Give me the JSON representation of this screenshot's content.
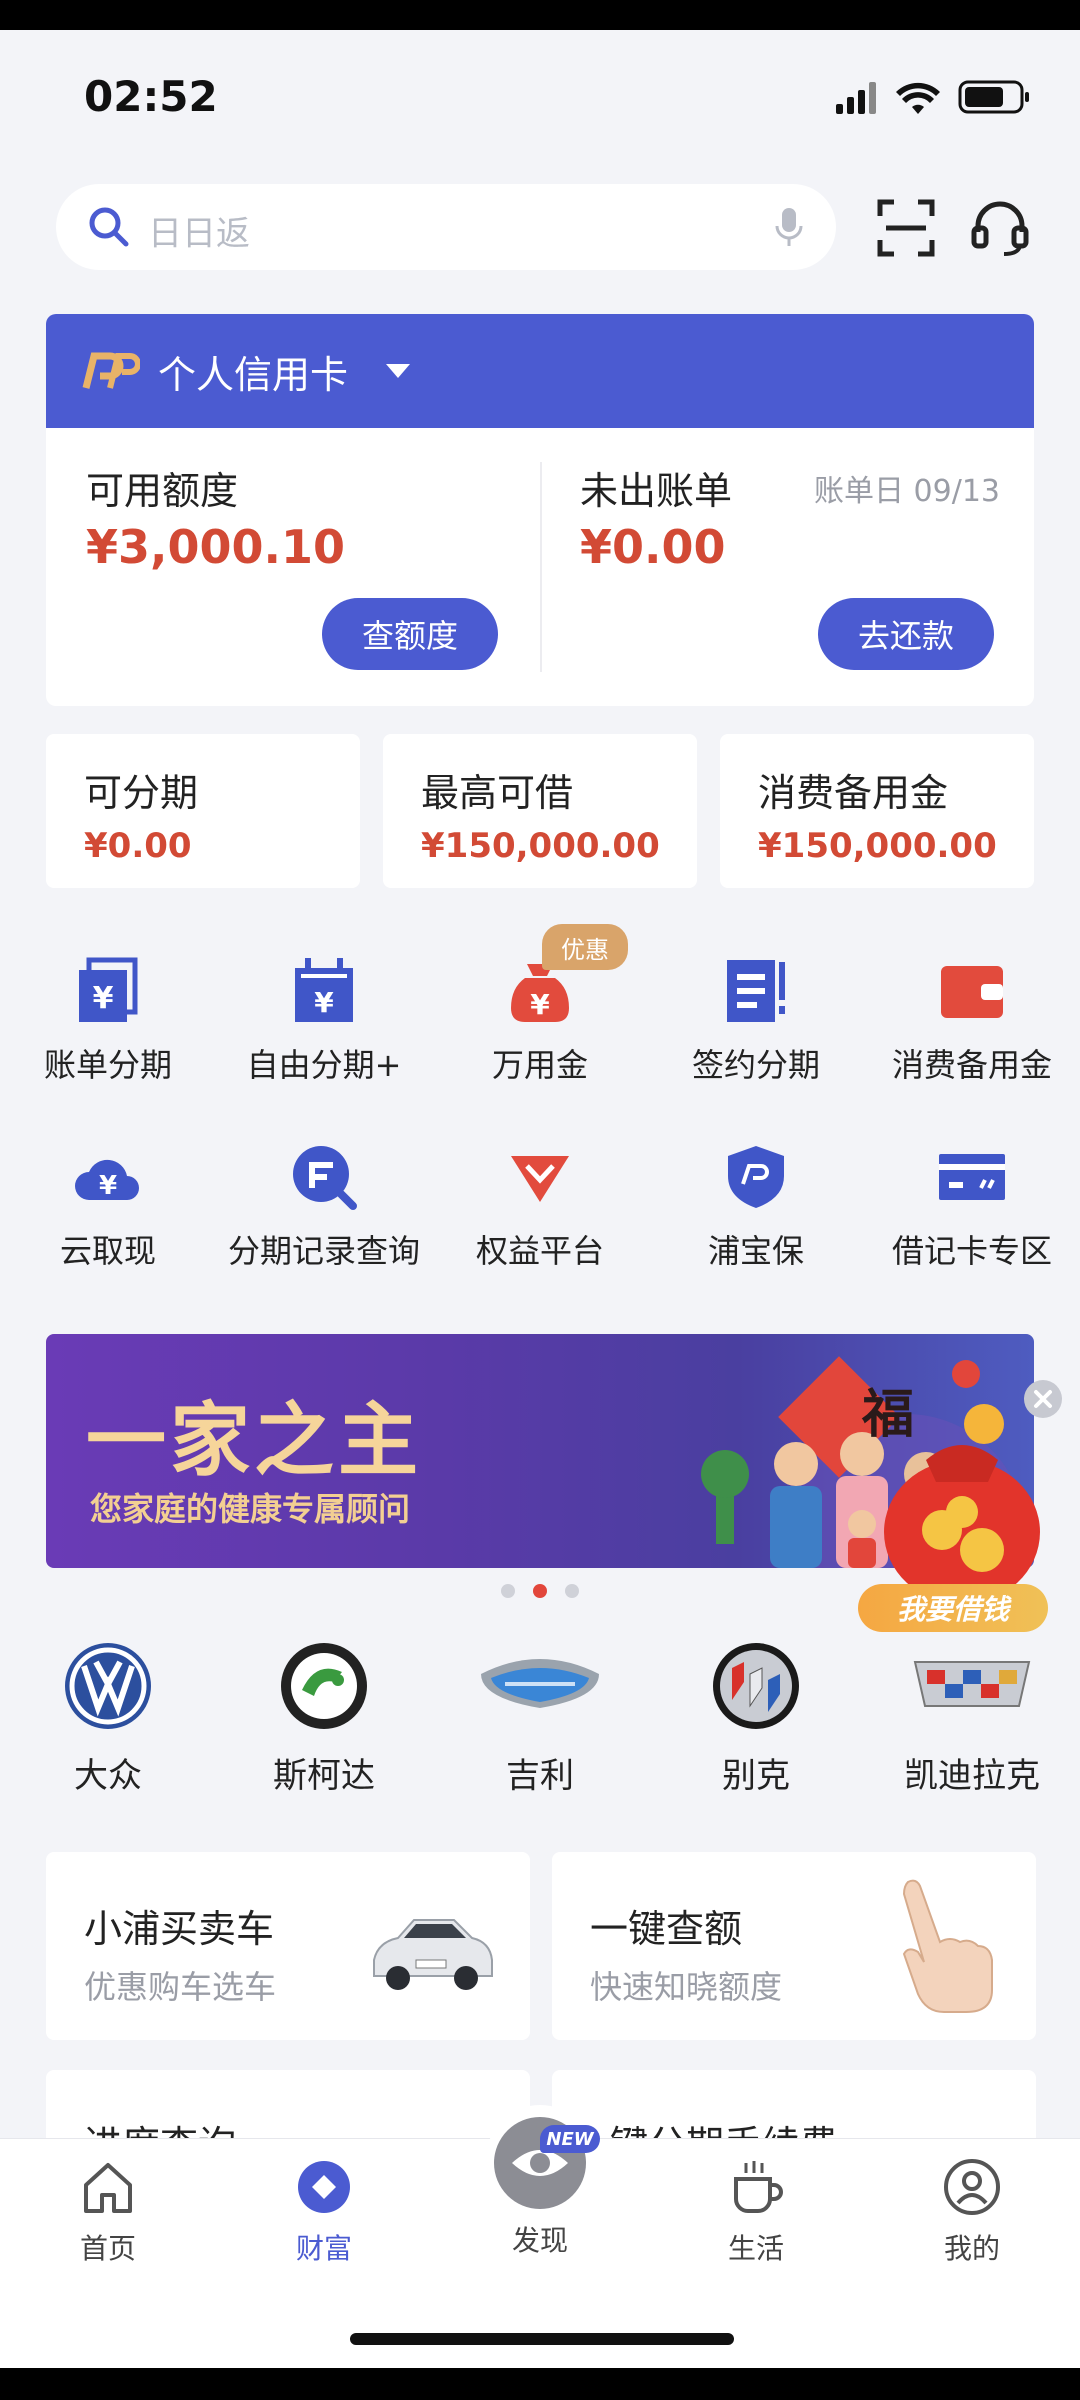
{
  "status": {
    "time": "02:52"
  },
  "search": {
    "placeholder": "日日返"
  },
  "card": {
    "title": "个人信用卡",
    "left": {
      "label": "可用额度",
      "amount": "¥3,000.10",
      "button": "查额度"
    },
    "right": {
      "label": "未出账单",
      "bill_date": "账单日 09/13",
      "amount": "¥0.00",
      "button": "去还款"
    }
  },
  "mini_cards": [
    {
      "title": "可分期",
      "value": "¥0.00"
    },
    {
      "title": "最高可借",
      "value": "¥150,000.00"
    },
    {
      "title": "消费备用金",
      "value": "¥150,000.00"
    }
  ],
  "grid": {
    "row1": [
      "账单分期",
      "自由分期+",
      "万用金",
      "签约分期",
      "消费备用金"
    ],
    "row2": [
      "云取现",
      "分期记录查询",
      "权益平台",
      "浦宝保",
      "借记卡专区"
    ],
    "promo_badge": "优惠"
  },
  "banner": {
    "title": "一家之主",
    "subtitle": "您家庭的健康专属顾问",
    "fu": "福",
    "cta": "我要借钱",
    "pages": 3,
    "active_page": 2
  },
  "brands": [
    "大众",
    "斯柯达",
    "吉利",
    "别克",
    "凯迪拉克"
  ],
  "services": [
    {
      "title": "小浦买卖车",
      "subtitle": "优惠购车选车"
    },
    {
      "title": "一键查额",
      "subtitle": "快速知晓额度"
    }
  ],
  "partial_services": [
    "进度查询",
    "一键分期手续费"
  ],
  "nav": {
    "tabs": [
      "首页",
      "财富",
      "发现",
      "生活",
      "我的"
    ],
    "active": "财富",
    "new_badge": "NEW"
  },
  "colors": {
    "primary": "#4b5bd1",
    "amount_red": "#d24a35",
    "icon_red": "#e24b3d",
    "icon_blue": "#4056c8"
  }
}
